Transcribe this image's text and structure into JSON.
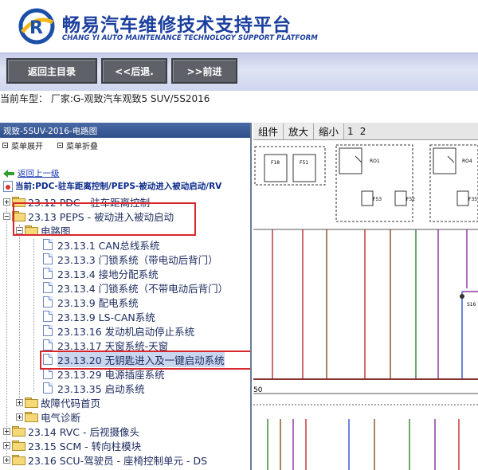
{
  "header": {
    "brand_cn": "畅易汽车维修技术支持平台",
    "brand_en": "CHANG YI AUTO MAINTENANCE TECHNOLOGY SUPPORT PLATFORM"
  },
  "toolbar": {
    "home_label": "返回主目录",
    "back_label": "<<后退.",
    "forward_label": ">>前进"
  },
  "vehicle_line": "当前车型：  厂家:G-观致汽车观致5 SUV/5S2016",
  "left_panel": {
    "title": "观致-5SUV-2016-电路图",
    "expand_label": "菜单展开",
    "collapse_label": "菜单折叠",
    "up_link": "返回上一级",
    "current_path": "当前:PDC-驻车距离控制/PEPS-被动进入被动启动/RV"
  },
  "tree": [
    {
      "label": "23.12 PDC - 驻车距离控制"
    },
    {
      "label": "23.13 PEPS - 被动进入被动启动"
    },
    {
      "label": "电路图"
    },
    {
      "label": "23.13.1 CAN总线系统"
    },
    {
      "label": "23.13.3 门锁系统（带电动后背门）"
    },
    {
      "label": "23.13.4 接地分配系统"
    },
    {
      "label": "23.13.4 门锁系统（不带电动后背门）"
    },
    {
      "label": "23.13.9 配电系统"
    },
    {
      "label": "23.13.9 LS-CAN系统"
    },
    {
      "label": "23.13.16 发动机启动停止系统"
    },
    {
      "label": "23.13.17 天窗系统-天窗"
    },
    {
      "label": "23.13.20 无钥匙进入及一键启动系统"
    },
    {
      "label": "23.13.29 电源插座系统"
    },
    {
      "label": "23.13.35 启动系统"
    },
    {
      "label": "故障代码首页"
    },
    {
      "label": "电气诊断"
    },
    {
      "label": "23.14 RVC - 后视摄像头"
    },
    {
      "label": "23.15 SCM - 转向柱模块"
    },
    {
      "label": "23.16 SCU-驾驶员 - 座椅控制单元 - DS"
    }
  ],
  "diagram_toolbar": {
    "fit_label": "组件",
    "zoom_in_label": "放大",
    "zoom_out_label": "缩小",
    "page1": "1",
    "page2": "2"
  },
  "diagram": {
    "fuse_labels": [
      "F18",
      "F51",
      "F53",
      "F52",
      "F35"
    ],
    "relay_labels": [
      "RO1",
      "RO4"
    ],
    "splice_label": "S16",
    "left_number": "50",
    "wire_colors": {
      "red": "#c23b3b",
      "green": "#3a8a3a",
      "purple": "#8a3ca0",
      "brown": "#8a5a2a",
      "blue": "#3a5ad0"
    }
  }
}
